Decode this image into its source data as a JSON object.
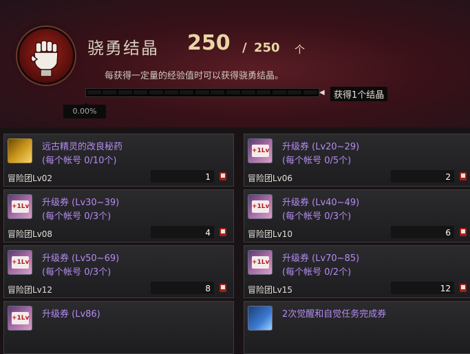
{
  "header": {
    "title": "骁勇结晶",
    "current": "250",
    "separator": "/",
    "max": "250",
    "unit": "个",
    "description": "每获得一定量的经验值时可以获得骁勇结晶。",
    "progress_fraction": 0.0,
    "percent_text": "0.00%",
    "gain_label": "获得1个结晶"
  },
  "items": [
    {
      "name": "远古精灵的改良秘药",
      "limit": "(每个帐号 0/10个)",
      "level": "冒险团Lv02",
      "qty": "1",
      "icon": "potion-icon"
    },
    {
      "name": "升级券 (Lv20~29)",
      "limit": "(每个帐号 0/5个)",
      "level": "冒险团Lv06",
      "qty": "2",
      "icon": "level-up-ticket-icon"
    },
    {
      "name": "升级券 (Lv30~39)",
      "limit": "(每个帐号 0/3个)",
      "level": "冒险团Lv08",
      "qty": "4",
      "icon": "level-up-ticket-icon"
    },
    {
      "name": "升级券 (Lv40~49)",
      "limit": "(每个帐号 0/3个)",
      "level": "冒险团Lv10",
      "qty": "6",
      "icon": "level-up-ticket-icon"
    },
    {
      "name": "升级券 (Lv50~69)",
      "limit": "(每个帐号 0/3个)",
      "level": "冒险团Lv12",
      "qty": "8",
      "icon": "level-up-ticket-icon"
    },
    {
      "name": "升级券 (Lv70~85)",
      "limit": "(每个帐号 0/2个)",
      "level": "冒险团Lv15",
      "qty": "12",
      "icon": "level-up-ticket-icon"
    },
    {
      "name": "升级券 (Lv86)",
      "limit": "",
      "level": "",
      "qty": "",
      "icon": "level-up-ticket-icon"
    },
    {
      "name": "2次觉醒和自觉任务完成券",
      "limit": "",
      "level": "",
      "qty": "",
      "icon": "quest-complete-ticket-icon"
    }
  ],
  "colors": {
    "accent_purple": "#b58bf0",
    "gold": "#e8d6a6",
    "header_red": "#5a1d25"
  }
}
